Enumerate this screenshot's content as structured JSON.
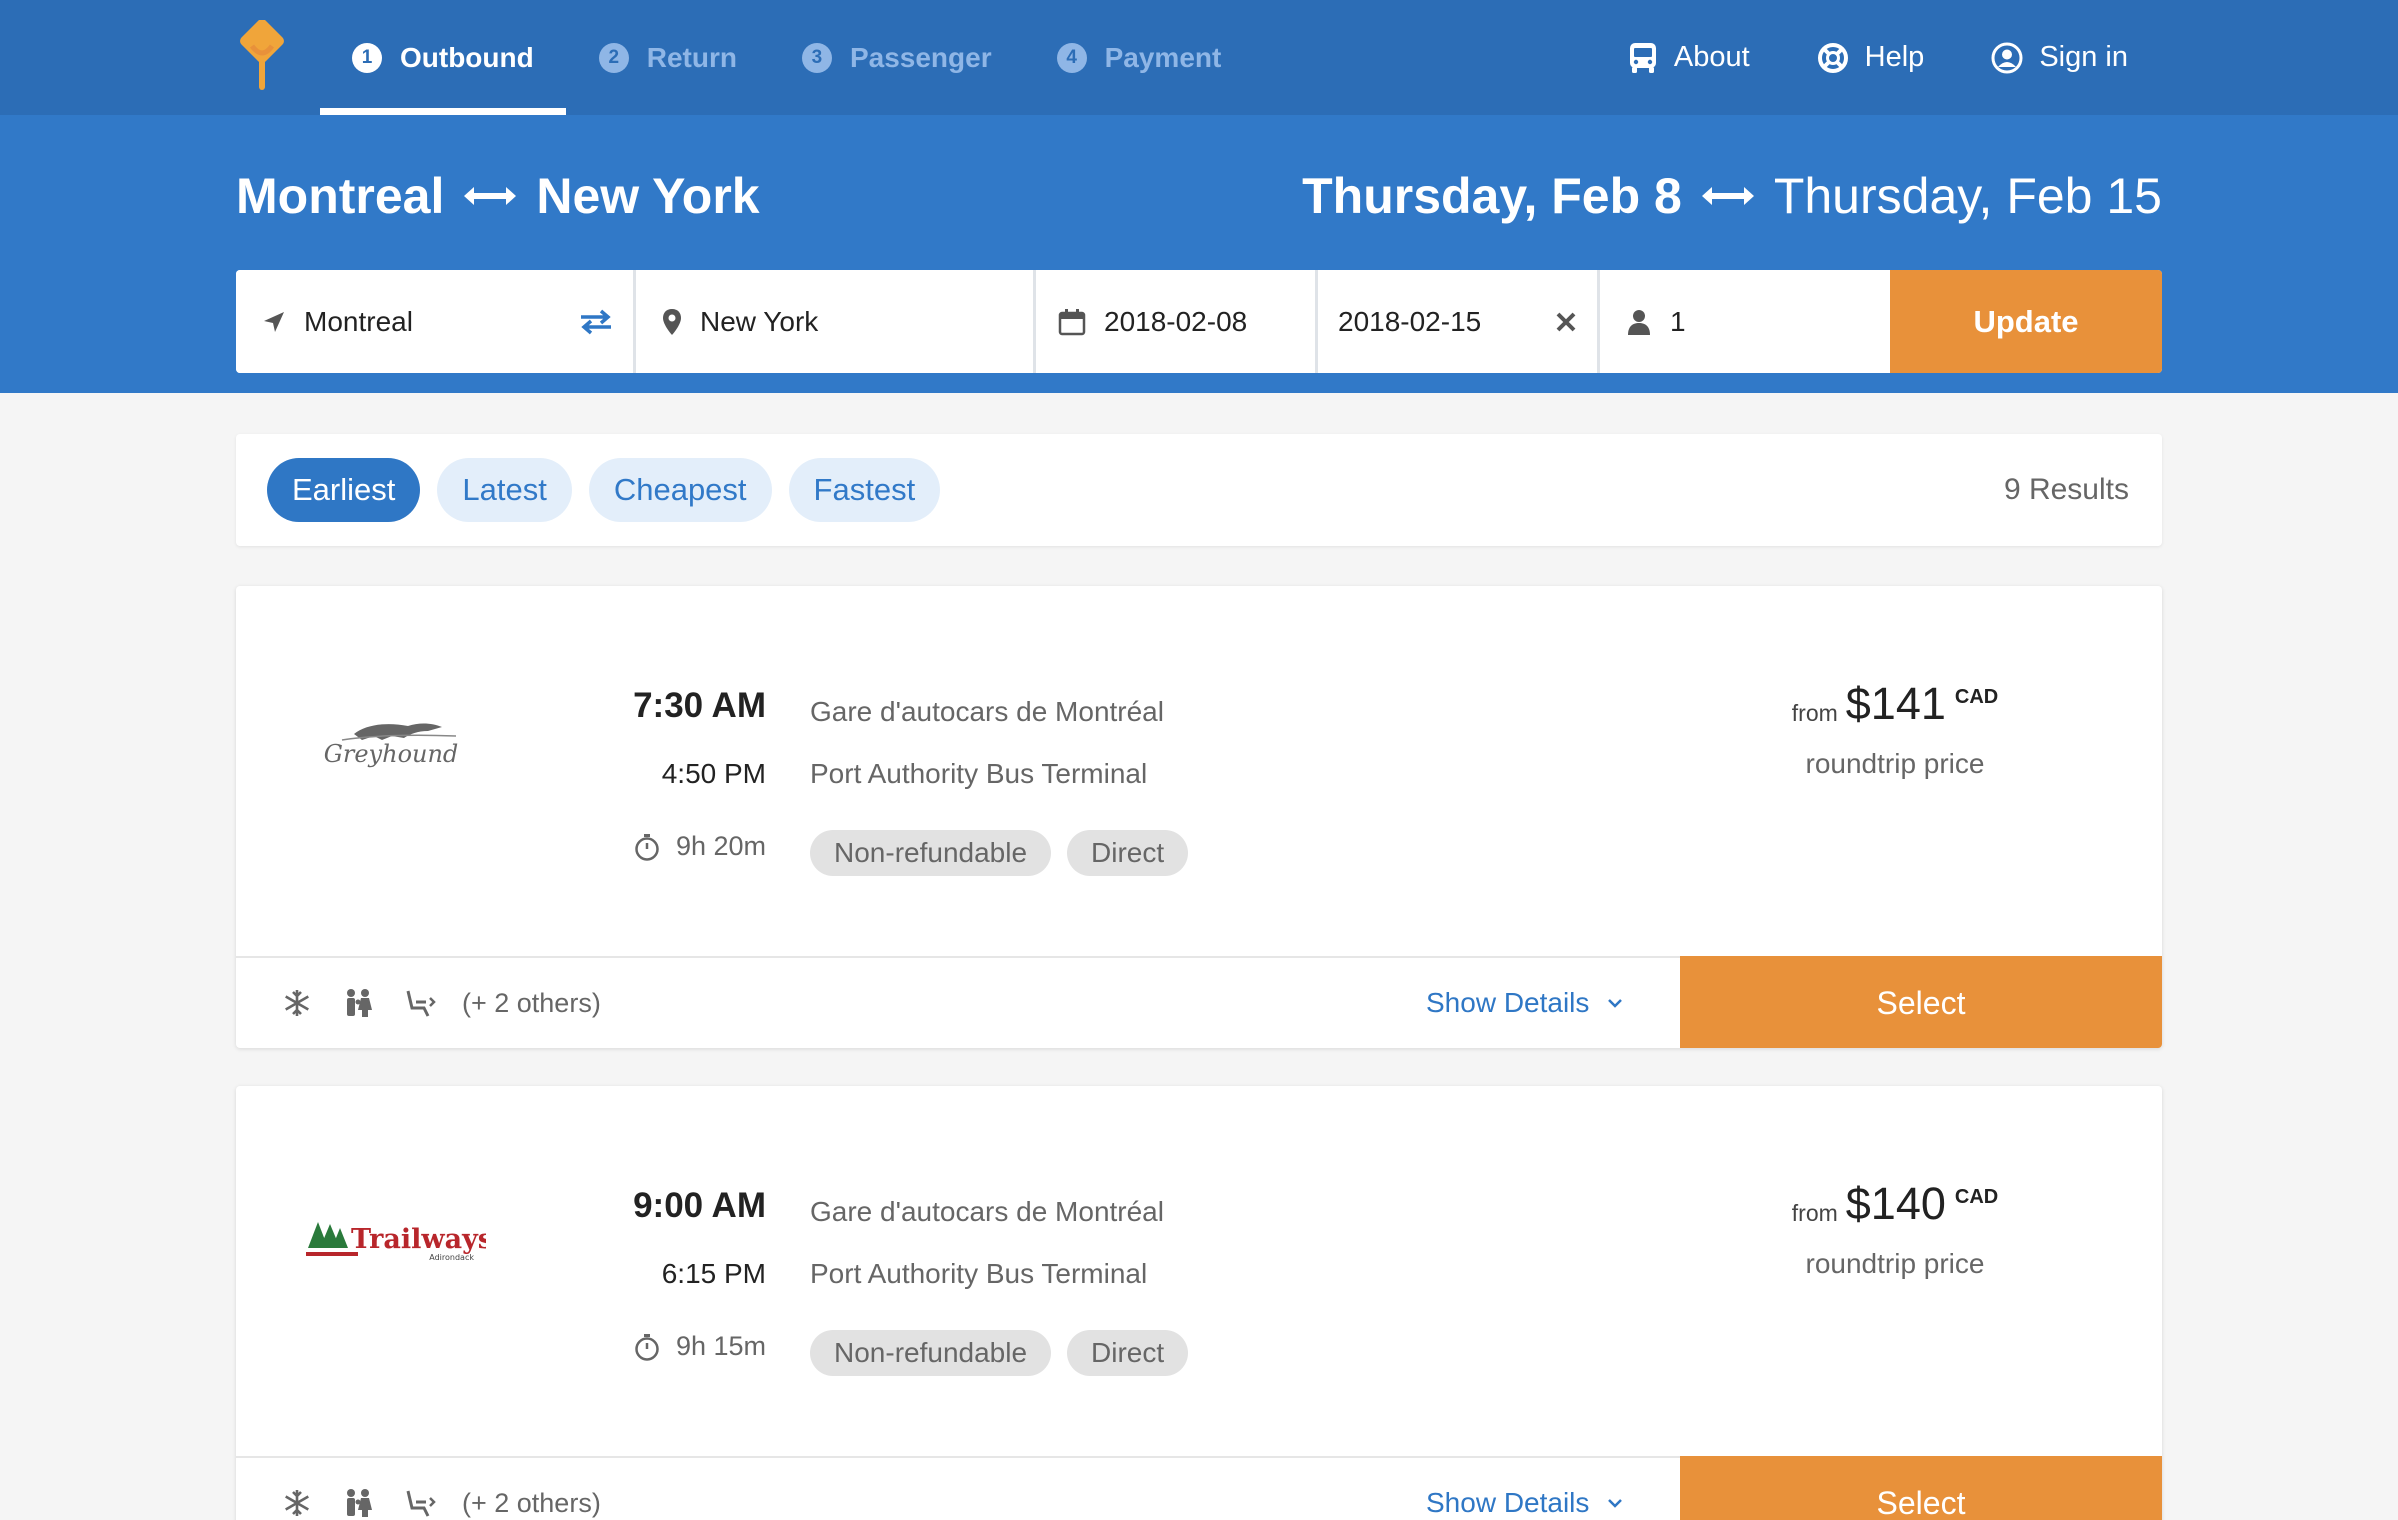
{
  "nav": {
    "steps": [
      {
        "number": "1",
        "label": "Outbound",
        "active": true
      },
      {
        "number": "2",
        "label": "Return",
        "active": false
      },
      {
        "number": "3",
        "label": "Passenger",
        "active": false
      },
      {
        "number": "4",
        "label": "Payment",
        "active": false
      }
    ],
    "links": {
      "about": "About",
      "help": "Help",
      "signin": "Sign in"
    }
  },
  "header": {
    "origin_city": "Montreal",
    "destination_city": "New York",
    "depart_date_long": "Thursday, Feb 8",
    "return_date_long": "Thursday, Feb 15"
  },
  "search": {
    "origin": "Montreal",
    "destination": "New York",
    "depart_date": "2018-02-08",
    "return_date": "2018-02-15",
    "passengers": "1",
    "update_label": "Update"
  },
  "sort": {
    "options": [
      "Earliest",
      "Latest",
      "Cheapest",
      "Fastest"
    ],
    "active": "Earliest",
    "results_count": "9 Results"
  },
  "results": [
    {
      "carrier": "Greyhound",
      "departure_time": "7:30 AM",
      "arrival_time": "4:50 PM",
      "departure_station": "Gare d'autocars de Montréal",
      "arrival_station": "Port Authority Bus Terminal",
      "duration": "9h 20m",
      "tags": [
        "Non-refundable",
        "Direct"
      ],
      "price_prefix": "from",
      "price": "$141",
      "currency": "CAD",
      "price_note": "roundtrip price",
      "amenities_others": "(+ 2 others)",
      "details_label": "Show Details",
      "select_label": "Select"
    },
    {
      "carrier": "Trailways",
      "carrier_sub": "Adirondack",
      "departure_time": "9:00 AM",
      "arrival_time": "6:15 PM",
      "departure_station": "Gare d'autocars de Montréal",
      "arrival_station": "Port Authority Bus Terminal",
      "duration": "9h 15m",
      "tags": [
        "Non-refundable",
        "Direct"
      ],
      "price_prefix": "from",
      "price": "$140",
      "currency": "CAD",
      "price_note": "roundtrip price",
      "amenities_others": "(+ 2 others)",
      "details_label": "Show Details",
      "select_label": "Select"
    }
  ],
  "colors": {
    "nav_bg": "#2c6db6",
    "banner_bg": "#3179c8",
    "accent_orange": "#e8913a",
    "link_blue": "#2f77c5"
  },
  "icons": {
    "logo": "pin-logo-icon",
    "about": "bus-icon",
    "help": "lifebuoy-icon",
    "signin": "user-circle-icon",
    "origin": "location-arrow-icon",
    "swap": "swap-icon",
    "destination": "map-pin-icon",
    "date": "calendar-icon",
    "clear": "close-icon",
    "passengers": "person-icon",
    "duration": "stopwatch-icon",
    "amenity_ac": "snowflake-icon",
    "amenity_family": "family-icon",
    "amenity_seat": "reclining-seat-icon",
    "details": "chevron-down-icon"
  }
}
